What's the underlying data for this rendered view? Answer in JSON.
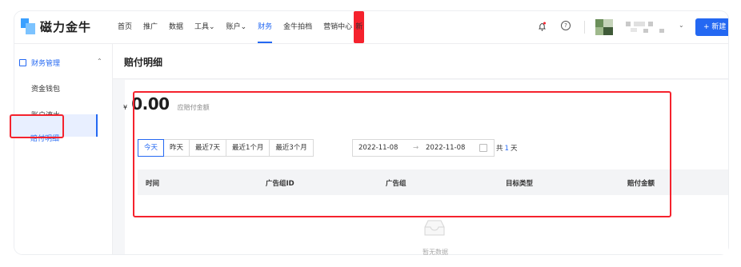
{
  "app": {
    "brand": "磁力金牛"
  },
  "nav": {
    "items": [
      "首页",
      "推广",
      "数据",
      "工具⌄",
      "账户⌄",
      "财务",
      "金牛拍档",
      "营销中心"
    ],
    "active": "财务",
    "new_badge": "新"
  },
  "header": {
    "help_glyph": "?",
    "user_caret": "⌄",
    "new_button": "+ 新建"
  },
  "sidebar": {
    "group_label": "财务管理",
    "group_caret": "⌃",
    "items": [
      "资金钱包",
      "账户流水",
      "赔付明细"
    ],
    "active": "赔付明细"
  },
  "page": {
    "title": "赔付明细"
  },
  "summary": {
    "currency": "¥",
    "amount": "0.00",
    "label": "应赔付金额"
  },
  "filters": {
    "range_buttons": [
      "今天",
      "昨天",
      "最近7天",
      "最近1个月",
      "最近3个月"
    ],
    "selected": "今天",
    "date_start": "2022-11-08",
    "date_arrow": "→",
    "date_end": "2022-11-08",
    "days_prefix": "共",
    "days_count": "1",
    "days_suffix": "天"
  },
  "table": {
    "columns": [
      "时间",
      "广告组ID",
      "广告组",
      "目标类型",
      "赔付金额"
    ],
    "empty_text": "暂无数据"
  },
  "colors": {
    "accent": "#2468f2",
    "highlight": "#f5222d"
  }
}
